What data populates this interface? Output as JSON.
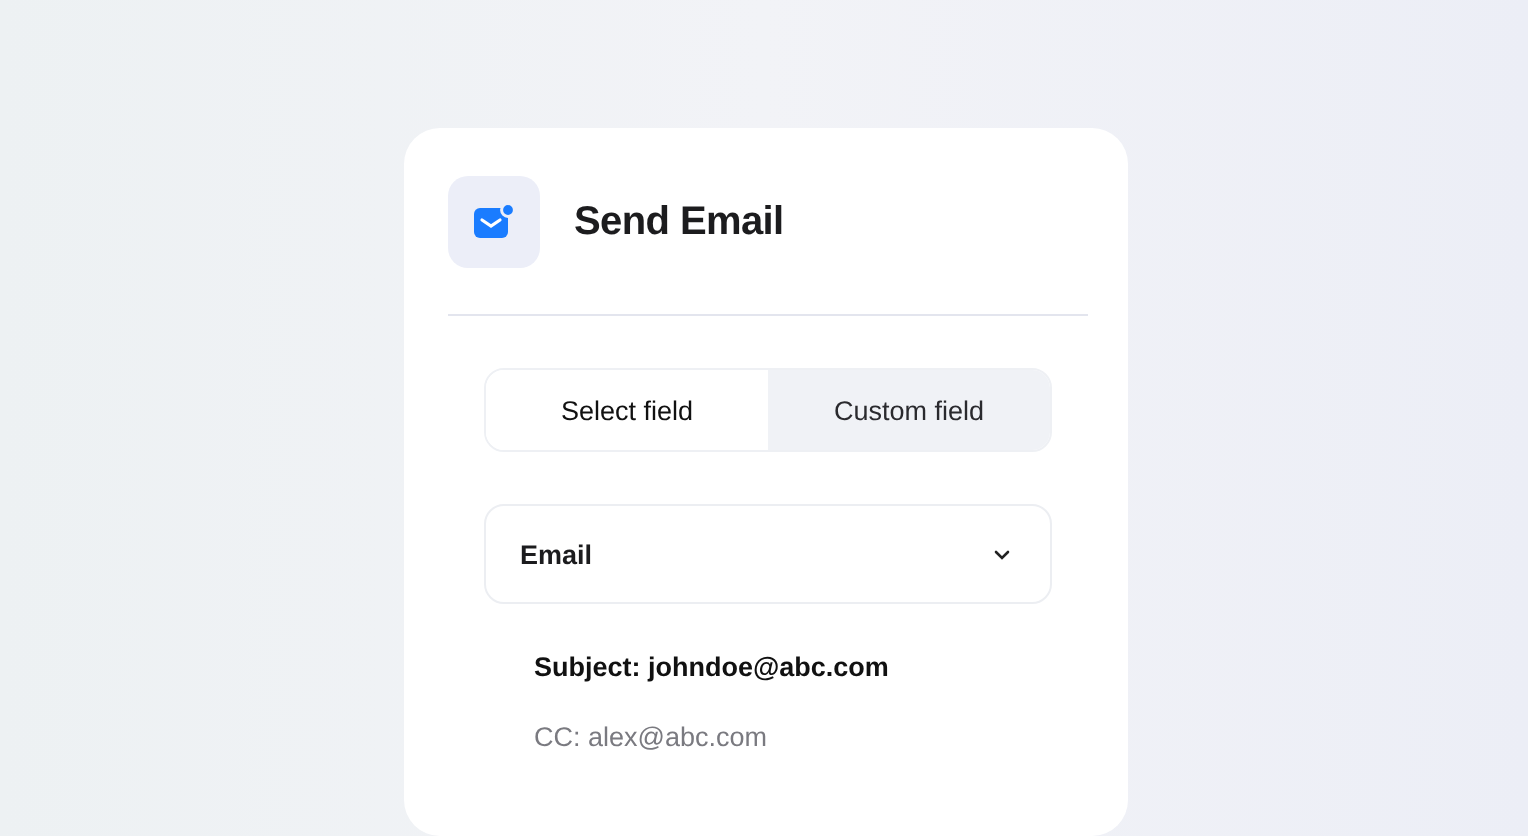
{
  "card": {
    "title": "Send Email",
    "tabs": [
      {
        "label": "Select field",
        "selected": true
      },
      {
        "label": "Custom field",
        "selected": false
      }
    ],
    "dropdown": {
      "value": "Email"
    },
    "lines": [
      {
        "text": "Subject: johndoe@abc.com",
        "kind": "primary"
      },
      {
        "text": "CC: alex@abc.com",
        "kind": "secondary"
      }
    ]
  }
}
